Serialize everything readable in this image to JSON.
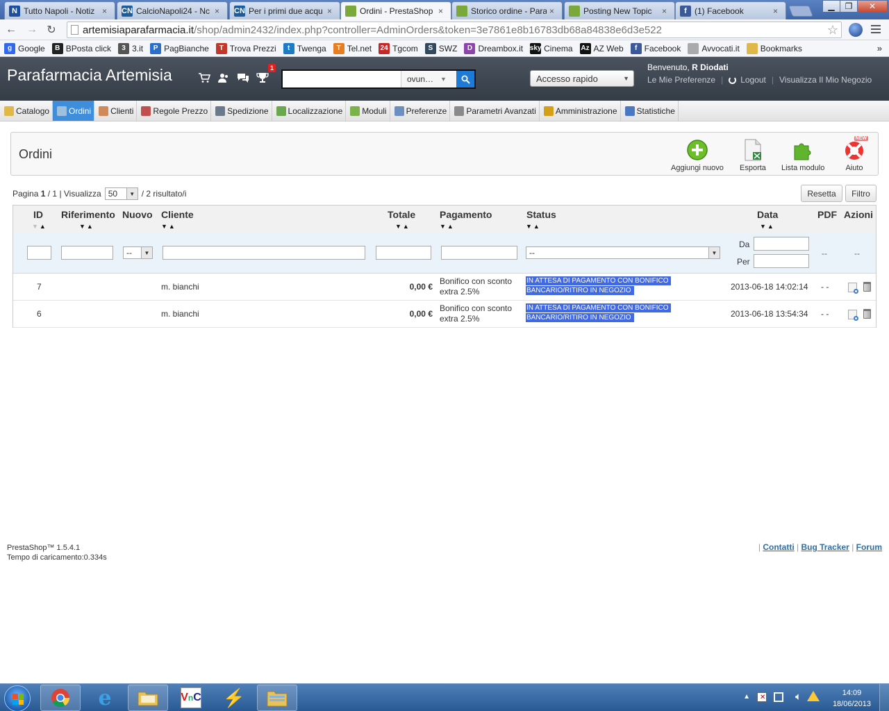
{
  "browser": {
    "tabs": [
      {
        "title": "Tutto Napoli - Notiz",
        "icon": "tuttonapoli-favicon",
        "color": "#1d4fa0",
        "glyph": "N",
        "active": false
      },
      {
        "title": "CalcioNapoli24 - Nc",
        "icon": "cn24-favicon",
        "color": "#1a5c9c",
        "glyph": "CN",
        "active": false
      },
      {
        "title": "Per i primi due acqu",
        "icon": "cn24-favicon",
        "color": "#1a5c9c",
        "glyph": "CN",
        "active": false
      },
      {
        "title": "Ordini - PrestaShop",
        "icon": "prestashop-favicon",
        "color": "#7aa83a",
        "glyph": "",
        "active": true
      },
      {
        "title": "Storico ordine - Para",
        "icon": "prestashop-favicon",
        "color": "#7aa83a",
        "glyph": "",
        "active": false
      },
      {
        "title": "Posting New Topic",
        "icon": "prestashop-favicon",
        "color": "#7aa83a",
        "glyph": "",
        "active": false
      },
      {
        "title": "(1) Facebook",
        "icon": "facebook-favicon",
        "color": "#3b5998",
        "glyph": "f",
        "active": false
      }
    ],
    "close_glyph": "×",
    "url_host": "artemisiaparafarmacia.it",
    "url_path": "/shop/admin2432/index.php?controller=AdminOrders&token=3e7861e8b16783db68a84838e6d3e522",
    "bookmarks": [
      {
        "label": "Google",
        "icon": "google-icon",
        "color": "#3369e8",
        "glyph": "g"
      },
      {
        "label": "BPosta click",
        "icon": "bposta-icon",
        "color": "#222",
        "glyph": "B"
      },
      {
        "label": "3.it",
        "icon": "tre-icon",
        "color": "#555",
        "glyph": "3"
      },
      {
        "label": "PagBianche",
        "icon": "pagbianche-icon",
        "color": "#2a6fc9",
        "glyph": "P"
      },
      {
        "label": "Trova Prezzi",
        "icon": "trovaprezzi-icon",
        "color": "#c0392b",
        "glyph": "T"
      },
      {
        "label": "Twenga",
        "icon": "twenga-icon",
        "color": "#1c7cc4",
        "glyph": "t"
      },
      {
        "label": "Tel.net",
        "icon": "telnet-icon",
        "color": "#e67e22",
        "glyph": "T"
      },
      {
        "label": "Tgcom",
        "icon": "tgcom-icon",
        "color": "#c62828",
        "glyph": "24"
      },
      {
        "label": "SWZ",
        "icon": "swz-icon",
        "color": "#34495e",
        "glyph": "S"
      },
      {
        "label": "Dreambox.it",
        "icon": "dreambox-icon",
        "color": "#8e44ad",
        "glyph": "D"
      },
      {
        "label": "Cinema",
        "icon": "sky-icon",
        "color": "#111",
        "glyph": "sky"
      },
      {
        "label": "AZ Web",
        "icon": "azweb-icon",
        "color": "#111",
        "glyph": "Az"
      },
      {
        "label": "Facebook",
        "icon": "facebook-icon",
        "color": "#3b5998",
        "glyph": "f"
      },
      {
        "label": "Avvocati.it",
        "icon": "page-icon",
        "color": "#aaa",
        "glyph": ""
      },
      {
        "label": "Bookmarks",
        "icon": "folder-icon",
        "color": "#e0b84a",
        "glyph": ""
      }
    ],
    "more_glyph": "»"
  },
  "header": {
    "shop_name": "Parafarmacia Artemisia",
    "notification_count": "1",
    "search_scope": "ovun…",
    "quick_access": "Accesso rapido",
    "welcome_prefix": "Benvenuto,",
    "user_name": "R Diodati",
    "preferences_link": "Le Mie Preferenze",
    "logout_link": "Logout",
    "view_shop_link": "Visualizza Il Mio Negozio"
  },
  "menu": [
    {
      "label": "Catalogo",
      "icon": "folder-icon",
      "color": "#e0b84a",
      "active": false
    },
    {
      "label": "Ordini",
      "icon": "cart-icon",
      "color": "#9fbfdf",
      "active": true
    },
    {
      "label": "Clienti",
      "icon": "user-icon",
      "color": "#d08a5a",
      "active": false
    },
    {
      "label": "Regole Prezzo",
      "icon": "price-rules-icon",
      "color": "#c0504d",
      "active": false
    },
    {
      "label": "Spedizione",
      "icon": "truck-icon",
      "color": "#6a7a8a",
      "active": false
    },
    {
      "label": "Localizzazione",
      "icon": "globe-icon",
      "color": "#6aa84f",
      "active": false
    },
    {
      "label": "Moduli",
      "icon": "puzzle-icon",
      "color": "#7bb34a",
      "active": false
    },
    {
      "label": "Preferenze",
      "icon": "preferences-icon",
      "color": "#6d8fbf",
      "active": false
    },
    {
      "label": "Parametri Avanzati",
      "icon": "wrench-icon",
      "color": "#8a8a8a",
      "active": false
    },
    {
      "label": "Amministrazione",
      "icon": "key-icon",
      "color": "#d4a017",
      "active": false
    },
    {
      "label": "Statistiche",
      "icon": "bar-chart-icon",
      "color": "#4a78c2",
      "active": false
    }
  ],
  "page": {
    "title": "Ordini",
    "toolbar": {
      "add_new": "Aggiungi nuovo",
      "export": "Esporta",
      "modules_list": "Lista modulo",
      "help": "Aiuto",
      "help_badge": "NEW"
    }
  },
  "pagination": {
    "prefix": "Pagina",
    "current": "1",
    "total": "/ 1",
    "show_label": "| Visualizza",
    "per_page": "50",
    "results": "/ 2 risultato/i",
    "reset_button": "Resetta",
    "filter_button": "Filtro"
  },
  "table": {
    "columns": {
      "id": "ID",
      "reference": "Riferimento",
      "new": "Nuovo",
      "customer": "Cliente",
      "total": "Totale",
      "payment": "Pagamento",
      "status": "Status",
      "date": "Data",
      "pdf": "PDF",
      "actions": "Azioni"
    },
    "filters": {
      "new_value": "--",
      "status_value": "--",
      "date_from_label": "Da",
      "date_to_label": "Per",
      "pdf_value": "--",
      "actions_value": "--"
    },
    "rows": [
      {
        "id": "7",
        "reference": "",
        "customer": "m. bianchi",
        "total": "0,00 €",
        "payment_line1": "Bonifico con sconto",
        "payment_line2": "extra 2.5%",
        "status": "IN ATTESA DI PAGAMENTO CON BONIFICO BANCARIO/RITIRO IN NEGOZIO",
        "status_color": "#4169e1",
        "date": "2013-06-18 14:02:14",
        "pdf": "-  -"
      },
      {
        "id": "6",
        "reference": "",
        "customer": "m. bianchi",
        "total": "0,00 €",
        "payment_line1": "Bonifico con sconto",
        "payment_line2": "extra 2.5%",
        "status": "IN ATTESA DI PAGAMENTO CON BONIFICO BANCARIO/RITIRO IN NEGOZIO",
        "status_color": "#4169e1",
        "date": "2013-06-18 13:54:34",
        "pdf": "-  -"
      }
    ]
  },
  "footer": {
    "version": "PrestaShop™ 1.5.4.1",
    "load_time": "Tempo di caricamento:0.334s",
    "contacts": "Contatti",
    "bug_tracker": "Bug Tracker",
    "forum": "Forum",
    "separator": "|"
  },
  "taskbar": {
    "time": "14:09",
    "date": "18/06/2013",
    "apps": [
      "chrome-icon",
      "internet-explorer-icon",
      "explorer-folder-icon",
      "vnc-icon",
      "winamp-icon",
      "file-manager-icon"
    ]
  }
}
